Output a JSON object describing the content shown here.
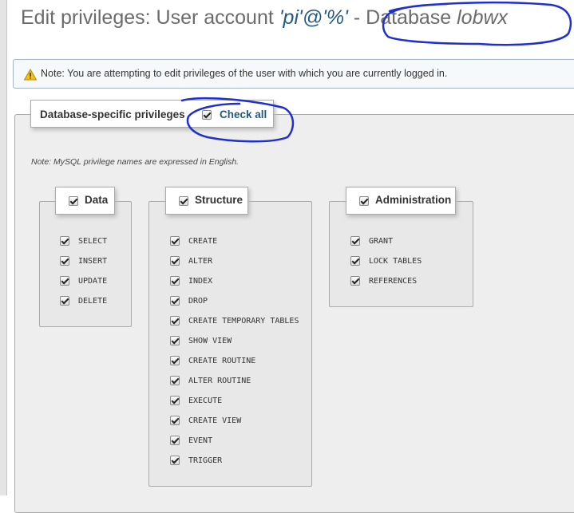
{
  "title": {
    "prefix": "Edit privileges: User account ",
    "account": "'pi'@'%'",
    "separator": " - ",
    "db_label": "Database ",
    "db_name": "lobwx"
  },
  "notice": {
    "icon": "warning-icon",
    "text": "Note: You are attempting to edit privileges of the user with which you are currently logged in."
  },
  "privileges": {
    "legend": "Database-specific privileges",
    "check_all": "Check all",
    "check_all_checked": true,
    "note": "Note: MySQL privilege names are expressed in English.",
    "groups": [
      {
        "name": "Data",
        "checked": true,
        "items": [
          "SELECT",
          "INSERT",
          "UPDATE",
          "DELETE"
        ]
      },
      {
        "name": "Structure",
        "checked": true,
        "items": [
          "CREATE",
          "ALTER",
          "INDEX",
          "DROP",
          "CREATE TEMPORARY TABLES",
          "SHOW VIEW",
          "CREATE ROUTINE",
          "ALTER ROUTINE",
          "EXECUTE",
          "CREATE VIEW",
          "EVENT",
          "TRIGGER"
        ]
      },
      {
        "name": "Administration",
        "checked": true,
        "items": [
          "GRANT",
          "LOCK TABLES",
          "REFERENCES"
        ]
      }
    ]
  },
  "colors": {
    "link": "#235a81",
    "annotation": "#1f2fd0"
  }
}
